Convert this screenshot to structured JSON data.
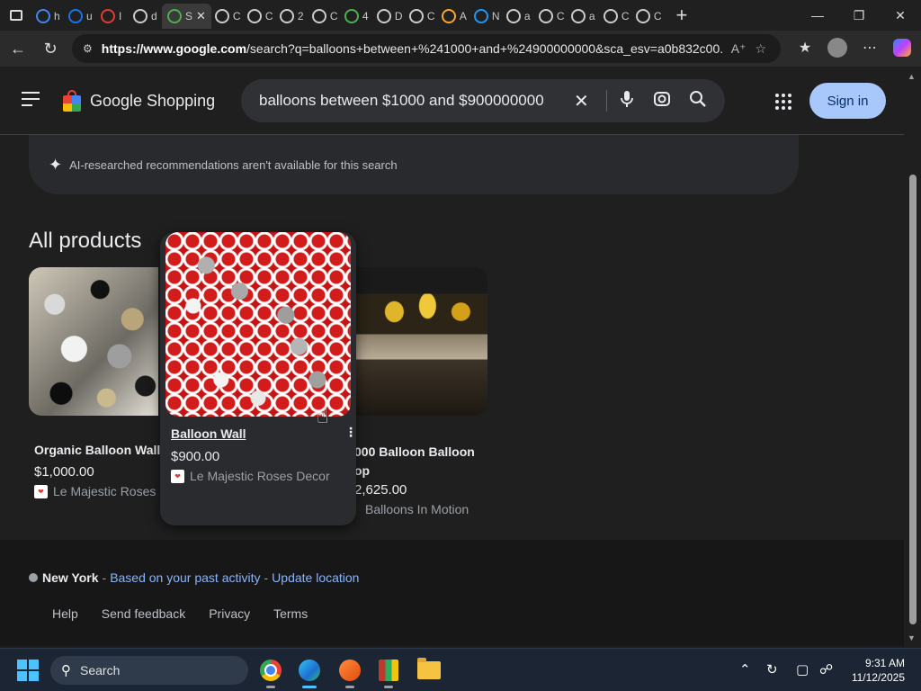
{
  "browser": {
    "tabs": [
      {
        "favicon": "google-icon",
        "title": "h",
        "color": "#4285f4"
      },
      {
        "favicon": "search-icon",
        "title": "u",
        "color": "#1a73e8"
      },
      {
        "favicon": "opera-icon",
        "title": "I",
        "color": "#e53935"
      },
      {
        "favicon": "globe-icon",
        "title": "d",
        "color": "#cccccc"
      },
      {
        "favicon": "monitor-icon",
        "title": "S",
        "color": "#4caf50",
        "active": true
      },
      {
        "favicon": "globe-icon",
        "title": "C",
        "color": "#cccccc"
      },
      {
        "favicon": "globe-icon",
        "title": "C",
        "color": "#cccccc"
      },
      {
        "favicon": "document-icon",
        "title": "2",
        "color": "#cccccc"
      },
      {
        "favicon": "globe-icon",
        "title": "C",
        "color": "#cccccc"
      },
      {
        "favicon": "dots-icon",
        "title": "4",
        "color": "#4caf50"
      },
      {
        "favicon": "globe-icon",
        "title": "D",
        "color": "#cccccc"
      },
      {
        "favicon": "globe-icon",
        "title": "C",
        "color": "#cccccc"
      },
      {
        "favicon": "vee-icon",
        "title": "A",
        "color": "#f9a825"
      },
      {
        "favicon": "wordpress-icon",
        "title": "N",
        "color": "#2196f3"
      },
      {
        "favicon": "document-icon",
        "title": "a",
        "color": "#cccccc"
      },
      {
        "favicon": "globe-icon",
        "title": "C",
        "color": "#cccccc"
      },
      {
        "favicon": "document-icon",
        "title": "a",
        "color": "#cccccc"
      },
      {
        "favicon": "globe-icon",
        "title": "C",
        "color": "#cccccc"
      },
      {
        "favicon": "globe-icon",
        "title": "C",
        "color": "#cccccc"
      }
    ],
    "active_tab_title": "S",
    "url_domain": "https://www.google.com",
    "url_rest": "/search?q=balloons+between+%241000+and+%24900000000&sca_esv=a0b832c00..."
  },
  "header": {
    "logo_text": "Google Shopping",
    "search_query": "balloons between $1000 and $900000000",
    "signin_label": "Sign in"
  },
  "ai_notice": "AI-researched recommendations aren't available for this search",
  "section_title": "All products",
  "products": [
    {
      "name": "Organic Balloon Wall",
      "price": "$1,000.00",
      "store": "Le Majestic Roses"
    },
    {
      "name": "Balloon Wall",
      "price": "$900.00",
      "store": "Le Majestic Roses Decor"
    },
    {
      "name_line1": "000 Balloon Balloon",
      "name_line2": "op",
      "price": "2,625.00",
      "store": "Balloons In Motion"
    }
  ],
  "location": {
    "city": "New York",
    "sep1": "-",
    "link1": "Based on your past activity",
    "sep2": "-",
    "link2": "Update location"
  },
  "footer": [
    "Help",
    "Send feedback",
    "Privacy",
    "Terms"
  ],
  "taskbar": {
    "search_label": "Search",
    "time": "9:31 AM",
    "date": "11/12/2025"
  },
  "colors": {
    "accent": "#a8c7fa",
    "link": "#8ab4f8",
    "background": "#1f1f1f"
  }
}
